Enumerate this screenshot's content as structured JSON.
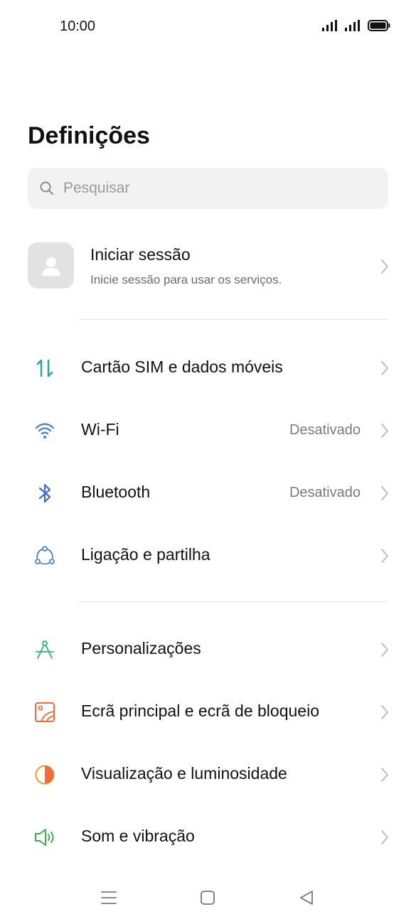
{
  "status_bar": {
    "time": "10:00"
  },
  "page": {
    "title": "Definições"
  },
  "search": {
    "placeholder": "Pesquisar"
  },
  "account": {
    "title": "Iniciar sessão",
    "subtitle": "Inicie sessão para usar os serviços."
  },
  "settings": [
    {
      "label": "Cartão SIM e dados móveis",
      "icon": "sim-data-arrows-icon",
      "value": ""
    },
    {
      "label": "Wi-Fi",
      "icon": "wifi-icon",
      "value": "Desativado"
    },
    {
      "label": "Bluetooth",
      "icon": "bluetooth-icon",
      "value": "Desativado"
    },
    {
      "label": "Ligação e partilha",
      "icon": "connection-sharing-icon",
      "value": ""
    },
    {
      "label": "Personalizações",
      "icon": "compass-icon",
      "value": ""
    },
    {
      "label": "Ecrã principal e ecrã de bloqueio",
      "icon": "wallpaper-icon",
      "value": ""
    },
    {
      "label": "Visualização e luminosidade",
      "icon": "brightness-icon",
      "value": ""
    },
    {
      "label": "Som e vibração",
      "icon": "speaker-icon",
      "value": ""
    }
  ],
  "colors": {
    "sim": "#1aa89a",
    "wifi": "#3f7ae0",
    "bluetooth": "#3f68d8",
    "sharing": "#4d7fd6",
    "personalize": "#2fb37a",
    "wallpaper": "#f26b3a",
    "brightness": "#f59a23",
    "sound": "#3fae4f"
  }
}
